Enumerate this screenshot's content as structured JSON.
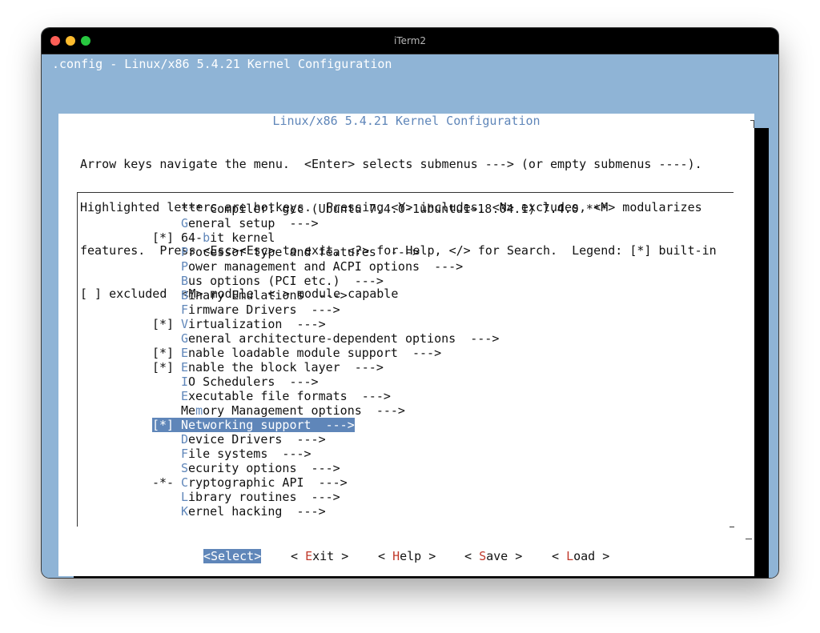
{
  "window": {
    "app_title": "iTerm2"
  },
  "backtitle": ".config - Linux/x86 5.4.21 Kernel Configuration",
  "dialog": {
    "title": "Linux/x86 5.4.21 Kernel Configuration",
    "help_lines": [
      "Arrow keys navigate the menu.  <Enter> selects submenus ---> (or empty submenus ----).",
      "Highlighted letters are hotkeys.  Pressing <Y> includes, <N> excludes, <M> modularizes",
      "features.  Press <Esc><Esc> to exit, <?> for Help, </> for Search.  Legend: [*] built-in",
      "[ ] excluded  <M> module  < > module capable"
    ]
  },
  "menu": {
    "items": [
      {
        "prefix": "",
        "pre": "*** Compiler: gcc (Ubuntu 7.4.0-1ubuntu1~18.04.1) 7.4.0 ***",
        "hotkey": "",
        "post": ""
      },
      {
        "prefix": "",
        "pre": "",
        "hotkey": "G",
        "post": "eneral setup  --->"
      },
      {
        "prefix": "[*]",
        "pre": "64-",
        "hotkey": "b",
        "post": "it kernel"
      },
      {
        "prefix": "",
        "pre": "",
        "hotkey": "P",
        "post": "rocessor type and features  --->"
      },
      {
        "prefix": "",
        "pre": "",
        "hotkey": "P",
        "post": "ower management and ACPI options  --->"
      },
      {
        "prefix": "",
        "pre": "",
        "hotkey": "B",
        "post": "us options (PCI etc.)  --->"
      },
      {
        "prefix": "",
        "pre": "",
        "hotkey": "B",
        "post": "inary Emulations  --->"
      },
      {
        "prefix": "",
        "pre": "",
        "hotkey": "F",
        "post": "irmware Drivers  --->"
      },
      {
        "prefix": "[*]",
        "pre": "",
        "hotkey": "V",
        "post": "irtualization  --->"
      },
      {
        "prefix": "",
        "pre": "",
        "hotkey": "G",
        "post": "eneral architecture-dependent options  --->"
      },
      {
        "prefix": "[*]",
        "pre": "",
        "hotkey": "E",
        "post": "nable loadable module support  --->"
      },
      {
        "prefix": "[*]",
        "pre": "",
        "hotkey": "E",
        "post": "nable the block layer  --->"
      },
      {
        "prefix": "",
        "pre": "",
        "hotkey": "I",
        "post": "O Schedulers  --->"
      },
      {
        "prefix": "",
        "pre": "",
        "hotkey": "E",
        "post": "xecutable file formats  --->"
      },
      {
        "prefix": "",
        "pre": "Me",
        "hotkey": "m",
        "post": "ory Management options  --->"
      },
      {
        "prefix": "[*]",
        "pre": "",
        "hotkey": "N",
        "post": "etworking support  --->",
        "selected": true
      },
      {
        "prefix": "",
        "pre": "",
        "hotkey": "D",
        "post": "evice Drivers  --->"
      },
      {
        "prefix": "",
        "pre": "",
        "hotkey": "F",
        "post": "ile systems  --->"
      },
      {
        "prefix": "",
        "pre": "",
        "hotkey": "S",
        "post": "ecurity options  --->"
      },
      {
        "prefix": "-*-",
        "pre": "",
        "hotkey": "C",
        "post": "ryptographic API  --->"
      },
      {
        "prefix": "",
        "pre": "",
        "hotkey": "L",
        "post": "ibrary routines  --->"
      },
      {
        "prefix": "",
        "pre": "",
        "hotkey": "K",
        "post": "ernel hacking  --->"
      }
    ]
  },
  "buttons": {
    "select": {
      "text": "<Select>"
    },
    "exit": {
      "open": "< ",
      "hotkey": "E",
      "rest": "xit",
      "close": " >"
    },
    "help": {
      "open": "< ",
      "hotkey": "H",
      "rest": "elp",
      "close": " >"
    },
    "save": {
      "open": "< ",
      "hotkey": "S",
      "rest": "ave",
      "close": " >"
    },
    "load": {
      "open": "< ",
      "hotkey": "L",
      "rest": "oad",
      "close": " >"
    }
  },
  "colors": {
    "terminal_background": "#8fb4d6",
    "highlight": "#5f86b9",
    "button_hotkey": "#c0392b"
  }
}
